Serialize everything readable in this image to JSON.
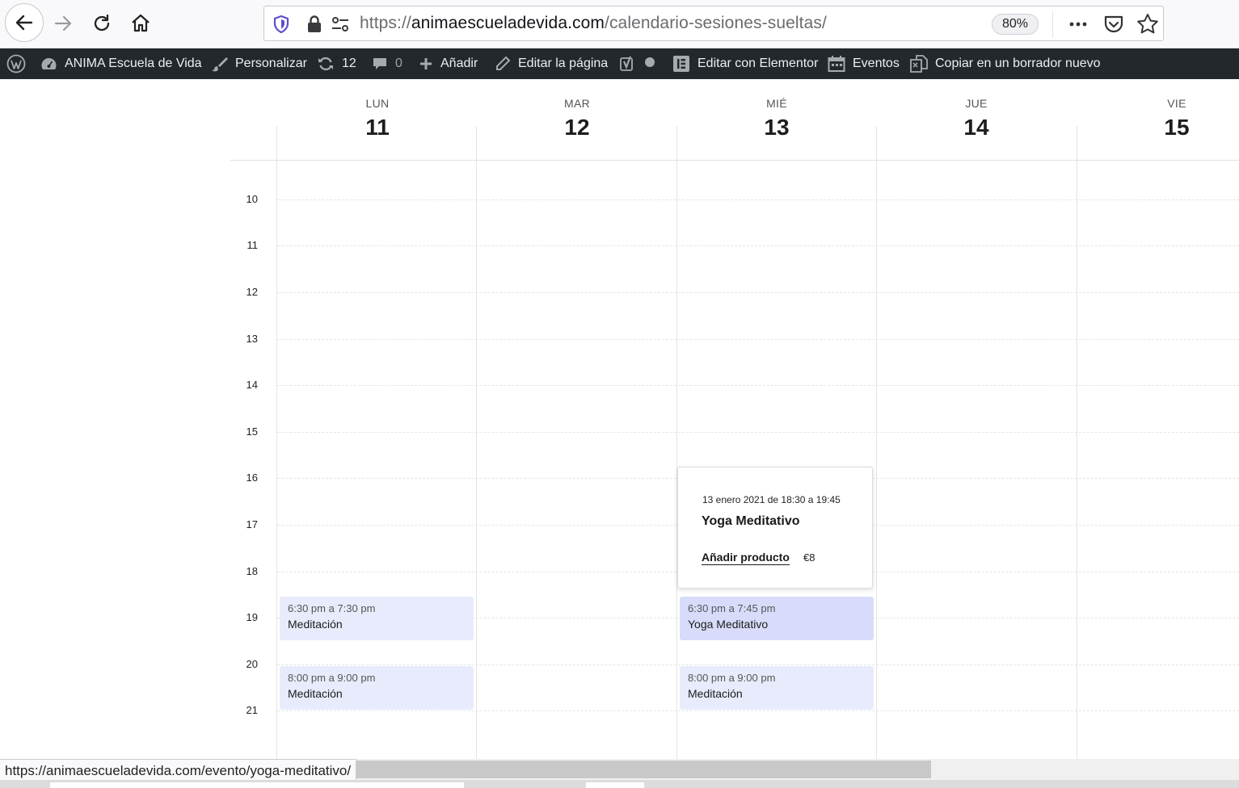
{
  "browser": {
    "url_prefix": "https://",
    "url_host": "animaescueladevida.com",
    "url_path": "/calendario-sesiones-sueltas/",
    "zoom": "80%"
  },
  "admin_bar": {
    "site_name": "ANIMA Escuela de Vida",
    "customize": "Personalizar",
    "updates_count": "12",
    "comments_count": "0",
    "add": "Añadir",
    "edit_page": "Editar la página",
    "edit_elementor": "Editar con Elementor",
    "events": "Eventos",
    "copy_draft": "Copiar en un borrador nuevo"
  },
  "calendar": {
    "days": [
      {
        "name": "LUN",
        "num": "11"
      },
      {
        "name": "MAR",
        "num": "12"
      },
      {
        "name": "MIÉ",
        "num": "13"
      },
      {
        "name": "JUE",
        "num": "14"
      },
      {
        "name": "VIE",
        "num": "15"
      }
    ],
    "hours": [
      "10",
      "11",
      "12",
      "13",
      "14",
      "15",
      "16",
      "17",
      "18",
      "19",
      "20",
      "21"
    ],
    "events": [
      {
        "time": "6:30 pm a 7:30 pm",
        "title": "Meditación"
      },
      {
        "time": "8:00 pm a 9:00 pm",
        "title": "Meditación"
      },
      {
        "time": "6:30 pm a 7:45 pm",
        "title": "Yoga Meditativo"
      },
      {
        "time": "8:00 pm a 9:00 pm",
        "title": "Meditación"
      }
    ],
    "popup": {
      "date": "13 enero 2021 de 18:30 a 19:45",
      "title": "Yoga Meditativo",
      "add_product": "Añadir producto",
      "price": "€8"
    }
  },
  "status_bar": {
    "url": "https://animaescueladevida.com/evento/yoga-meditativo/"
  },
  "colors": {
    "admin_bar_bg": "#23282d",
    "event_bg": "#e8ebfb",
    "event_active_bg": "#d8dcfa"
  }
}
